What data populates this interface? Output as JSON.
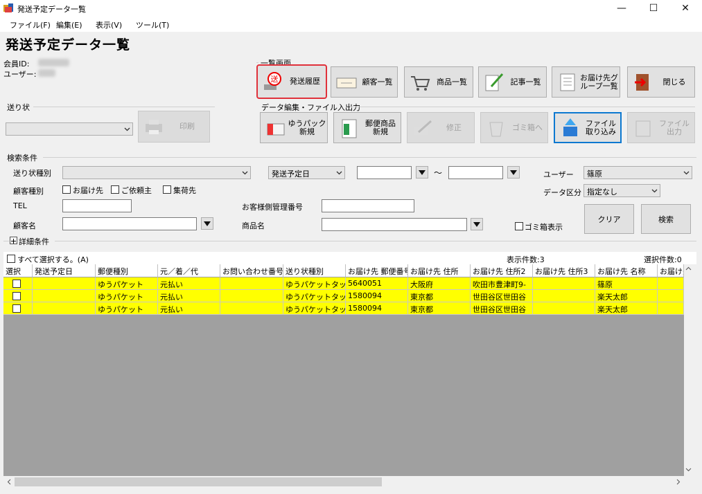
{
  "window": {
    "title": "発送予定データ一覧"
  },
  "menu": [
    "ファイル(F)",
    "編集(E)",
    "表示(V)",
    "ツール(T)"
  ],
  "page_title": "発送予定データ一覧",
  "member": {
    "id_label": "会員ID:",
    "user_label": "ユーザー:"
  },
  "okurijo": {
    "label": "送り状",
    "print_button": "印刷"
  },
  "ichiran": {
    "label": "一覧画面",
    "buttons": [
      "発送履歴",
      "顧客一覧",
      "商品一覧",
      "記事一覧",
      "お届け先グ\nループ一覧"
    ],
    "close_button": "閉じる"
  },
  "data_edit": {
    "label": "データ編集・ファイル入出力",
    "buttons": [
      "ゆうパック\n新規",
      "郵便商品\n新規",
      "修正",
      "ゴミ箱へ",
      "ファイル\n取り込み",
      "ファイル\n出力"
    ]
  },
  "search": {
    "label": "検索条件",
    "okurijo_type_label": "送り状種別",
    "date_type_value": "発送予定日",
    "tilde": "〜",
    "user_label": "ユーザー",
    "user_value": "篠原",
    "customer_type_label": "顧客種別",
    "chk_otodoke": "お届け先",
    "chk_goirai": "ご依頼主",
    "chk_shuka": "集荷先",
    "data_kubun_label": "データ区分",
    "data_kubun_value": "指定なし",
    "tel_label": "TEL",
    "okyaku_kanri_label": "お客様側管理番号",
    "customer_name_label": "顧客名",
    "product_name_label": "商品名",
    "trash_label": "ゴミ箱表示",
    "clear_button": "クリア",
    "search_button": "検索"
  },
  "detail_label": "詳細条件",
  "select_all_label": "すべて選択する。(A)",
  "display_count": "表示件数:3",
  "selected_count": "選択件数:0",
  "grid": {
    "columns": [
      "選択",
      "発送予定日",
      "郵便種別",
      "元／着／代",
      "お問い合わせ番号",
      "送り状種別",
      "お届け先 郵便番号",
      "お届け先 住所",
      "お届け先 住所2",
      "お届け先 住所3",
      "お届け先 名称",
      "お届け先"
    ],
    "rows": [
      [
        "",
        "",
        "ゆうパケット",
        "元払い",
        "",
        "ゆうパケットタックシ",
        "5640051",
        "大阪府",
        "吹田市豊津町9-",
        "",
        "篠原",
        ""
      ],
      [
        "",
        "",
        "ゆうパケット",
        "元払い",
        "",
        "ゆうパケットタックシ",
        "1580094",
        "東京都",
        "世田谷区世田谷",
        "",
        "楽天太郎",
        ""
      ],
      [
        "",
        "",
        "ゆうパケット",
        "元払い",
        "",
        "ゆうパケットタックシ",
        "1580094",
        "東京都",
        "世田谷区世田谷",
        "",
        "楽天太郎",
        ""
      ]
    ]
  }
}
